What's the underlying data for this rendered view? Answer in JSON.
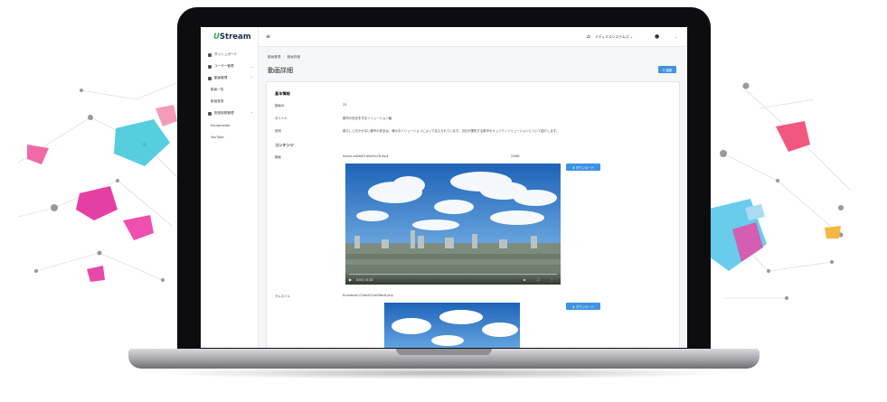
{
  "app": {
    "logo_mark": "U",
    "logo_text": "Stream"
  },
  "sidebar": {
    "items": [
      {
        "label": "ダッシュボード",
        "icon": "dashboard-icon"
      },
      {
        "label": "ユーザー管理",
        "icon": "user-icon"
      },
      {
        "label": "動画管理",
        "icon": "video-icon"
      }
    ],
    "video_sub": [
      {
        "label": "動画一覧"
      },
      {
        "label": "動画登録"
      }
    ],
    "delivery": {
      "label": "配信制御管理",
      "icon": "cloud-icon"
    },
    "delivery_sub": [
      {
        "label": "Equipmedia"
      },
      {
        "label": "YouTube"
      }
    ]
  },
  "topbar": {
    "menu_icon": "≡",
    "org_name": "メディエスシステムズ ⌄",
    "user_chevron": "⌄"
  },
  "breadcrumb": {
    "root": "動画管理",
    "separator": "/",
    "current": "動画詳細"
  },
  "page": {
    "title": "動画詳細",
    "edit_label": "☰ 編集"
  },
  "detail": {
    "basic_section": "基本情報",
    "id_label": "動画ID",
    "id_value": "25",
    "title_label": "タイトル",
    "title_value": "都市の安全を守るソリューション編",
    "desc_label": "説明",
    "desc_value": "暮らしと欠かせない都市の安全は、様々なソリューションによって支えられています。当社が提供する都市セキュリティソリューションについて紹介します。",
    "content_section": "コンテンツ",
    "video_label": "動画",
    "video_file": "movie-ed2b0f1d9d2fa76.mp4",
    "video_size": "22MB",
    "download_label": "⬇ ダウンロード",
    "thumb_label": "サムネイル",
    "thumb_file": "thumbnail-02de4224e09bc8.png"
  },
  "player": {
    "time": "0:00 / 0:15"
  },
  "colors": {
    "accent": "#3f93e4",
    "logo_green": "#36a852",
    "sky_top": "#1e63b8",
    "sky_bottom": "#8cc4ef"
  }
}
